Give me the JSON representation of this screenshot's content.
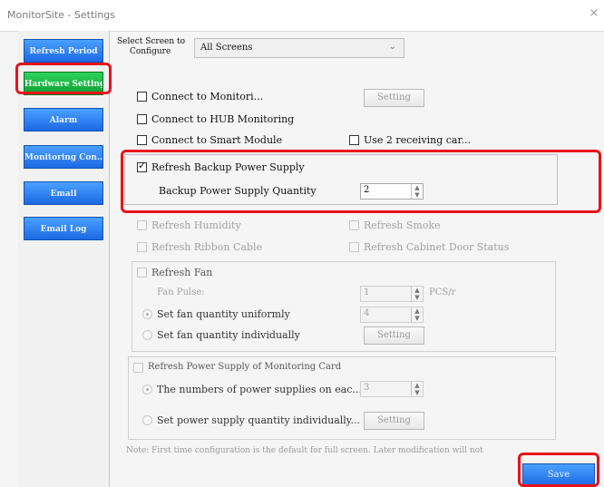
{
  "window": {
    "title": "MonitorSite - Settings",
    "close_glyph": "×"
  },
  "sidebar": {
    "items": [
      {
        "label": "Refresh Period",
        "active": false
      },
      {
        "label": "Hardware Settings",
        "active": true
      },
      {
        "label": "Alarm",
        "active": false
      },
      {
        "label": "Monitoring Con...",
        "active": false
      },
      {
        "label": "Email",
        "active": false
      },
      {
        "label": "Email Log",
        "active": false
      }
    ]
  },
  "screen_select": {
    "label_line1": "Select Screen to",
    "label_line2": "Configure",
    "value": "All Screens"
  },
  "options": {
    "connect_monitoring": {
      "label": "Connect to Monitori...",
      "checked": false,
      "button": "Setting"
    },
    "connect_hub": {
      "label": "Connect to HUB Monitoring",
      "checked": false
    },
    "connect_smart": {
      "label": "Connect to Smart Module",
      "checked": false
    },
    "use_two_receiving": {
      "label": "Use 2 receiving car...",
      "checked": false
    }
  },
  "backup_power": {
    "label": "Refresh Backup Power Supply",
    "checked": true,
    "quantity_label": "Backup Power Supply Quantity",
    "quantity_value": "2"
  },
  "refresh": {
    "humidity": "Refresh Humidity",
    "smoke": "Refresh Smoke",
    "ribbon": "Refresh Ribbon Cable",
    "cabinet_door": "Refresh Cabinet Door Status"
  },
  "fan": {
    "label": "Refresh Fan",
    "pulse_label": "Fan Pulse:",
    "pulse_value": "1",
    "pulse_unit": "PCS/r",
    "uniform_label": "Set fan quantity uniformly",
    "uniform_value": "4",
    "individual_label": "Set fan quantity individually",
    "button": "Setting"
  },
  "power_card": {
    "label": "Refresh Power Supply of Monitoring Card",
    "numbers_label": "The numbers of power supplies on eac...",
    "numbers_value": "3",
    "individual_label": "Set power supply quantity individually...",
    "button": "Setting"
  },
  "note": "Note: First time configuration is the default for full screen. Later modification will not",
  "save_label": "Save",
  "colors": {
    "highlight": "#e8131b",
    "nav_blue": "#1b69e4",
    "nav_green": "#0f9c32"
  },
  "icons": {
    "dropdown": "chevron-down-icon",
    "spin": "spin-arrows-icon",
    "check": "check-icon"
  }
}
